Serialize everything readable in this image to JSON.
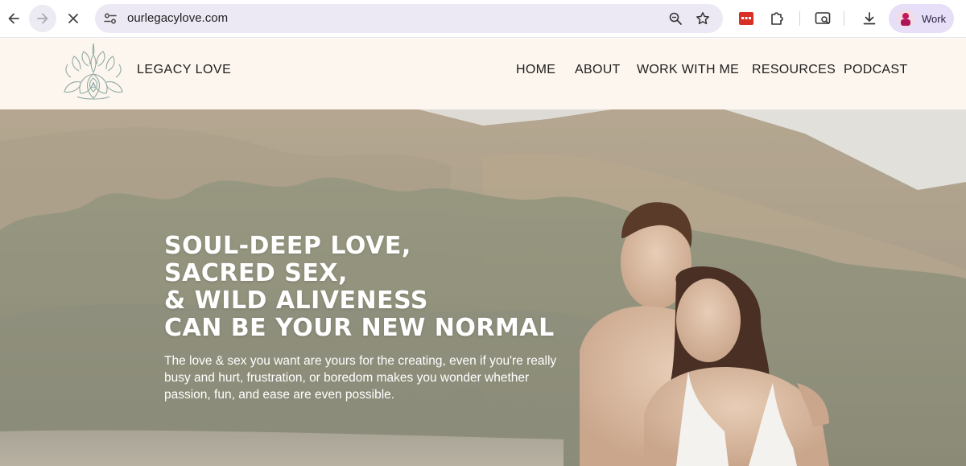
{
  "browser": {
    "url": "ourlegacylove.com",
    "profile_label": "Work",
    "icons": [
      "back-arrow-icon",
      "forward-arrow-icon",
      "stop-icon",
      "site-info-icon",
      "zoom-icon",
      "bookmark-star-icon",
      "extension-red-icon",
      "extensions-puzzle-icon",
      "tab-search-icon",
      "download-icon",
      "profile-avatar-icon"
    ]
  },
  "site": {
    "brand": "LEGACY LOVE",
    "nav": [
      "HOME",
      "ABOUT",
      "WORK WITH ME",
      "RESOURCES",
      "PODCAST"
    ],
    "header_bg": "#fdf6ee"
  },
  "hero": {
    "headline": [
      "SOUL-DEEP LOVE,",
      "SACRED SEX,",
      "& WILD ALIVENESS",
      "CAN BE YOUR NEW NORMAL"
    ],
    "subtext": "The love & sex you want are yours for the creating, even if you're really busy and hurt, frustration, or boredom makes you wonder whether passion, fun, and ease are even possible."
  }
}
